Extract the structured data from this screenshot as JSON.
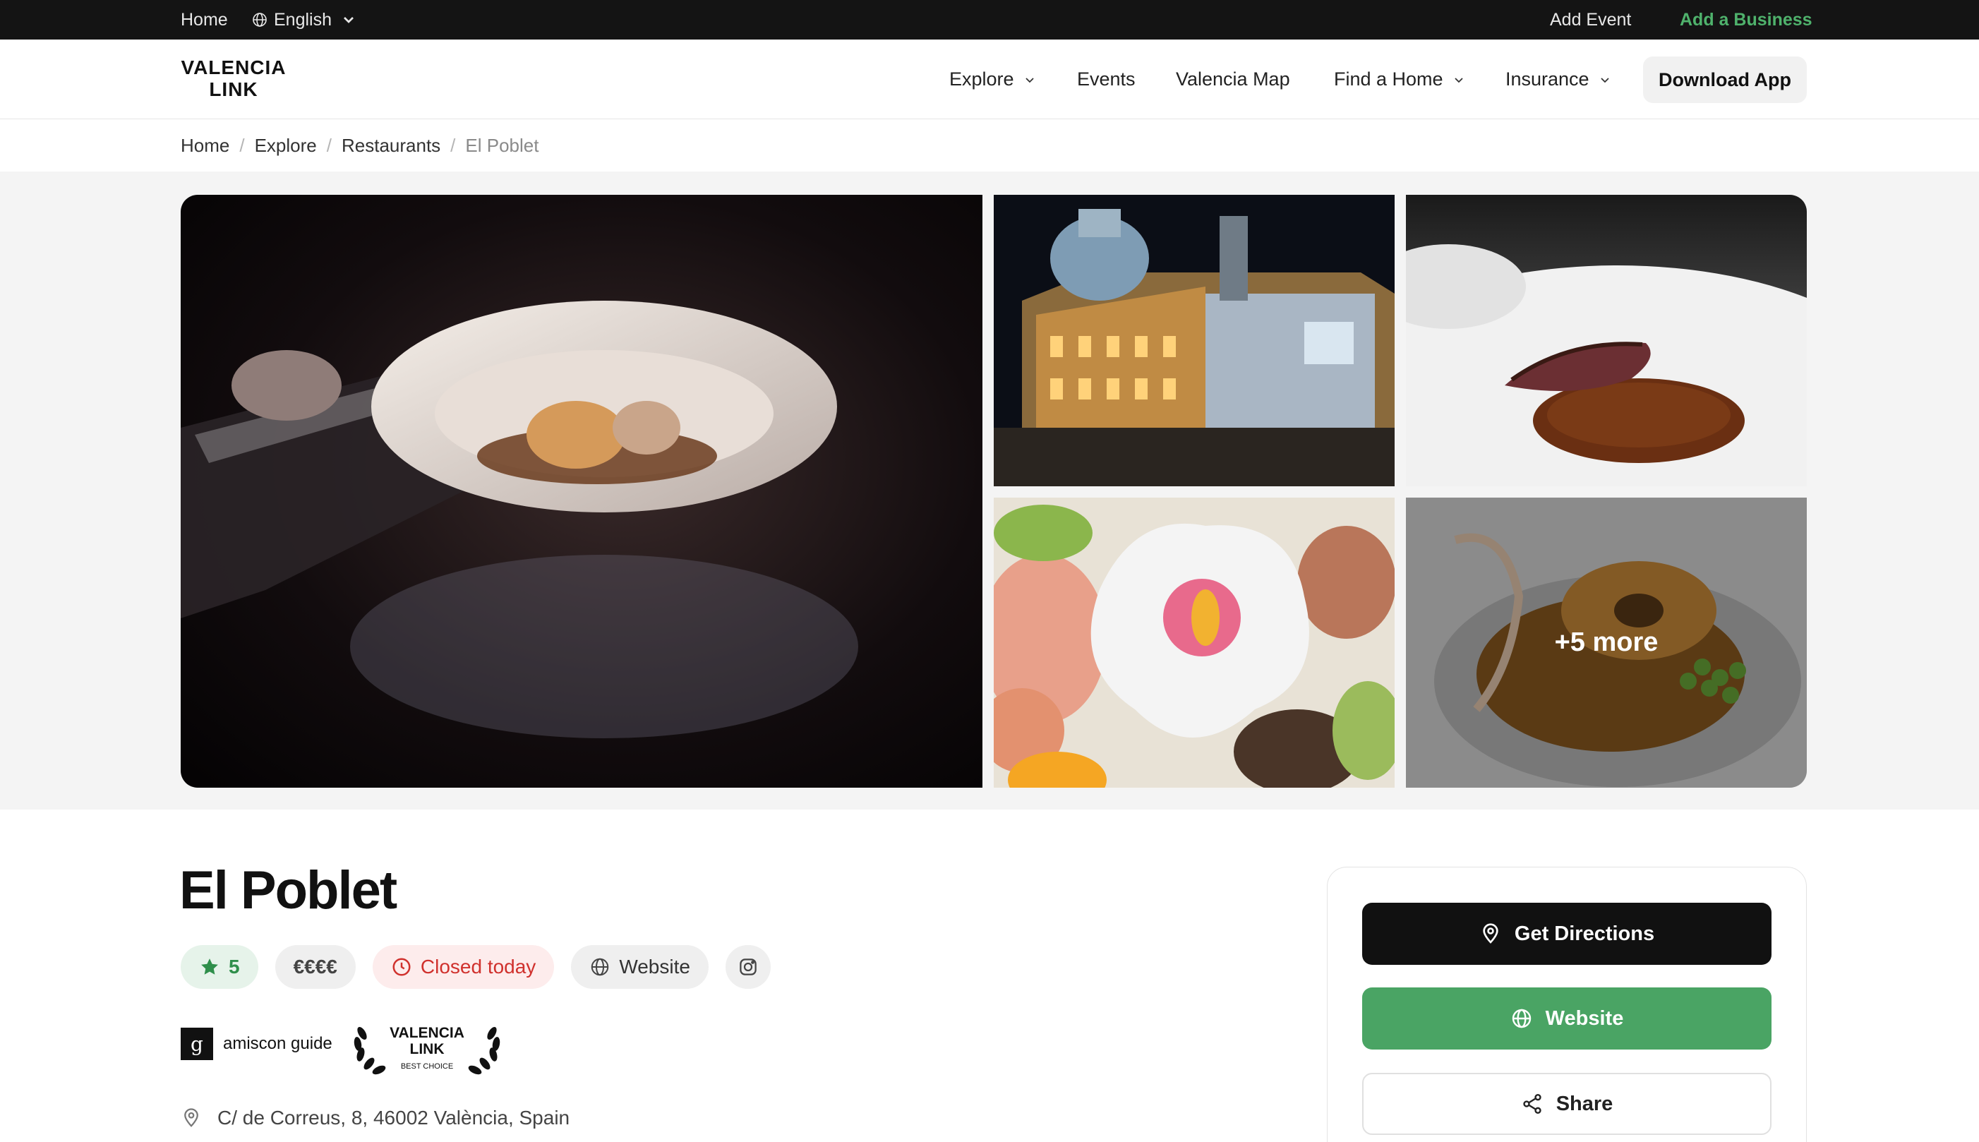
{
  "topbar": {
    "home": "Home",
    "language": "English",
    "add_event": "Add Event",
    "add_business": "Add a Business"
  },
  "header": {
    "logo_line1": "VALENCIA",
    "logo_line2": "LINK",
    "nav": {
      "explore": "Explore",
      "events": "Events",
      "map": "Valencia Map",
      "find_home": "Find a Home",
      "insurance": "Insurance"
    },
    "download": "Download App"
  },
  "breadcrumb": {
    "home": "Home",
    "explore": "Explore",
    "restaurants": "Restaurants",
    "current": "El Poblet"
  },
  "gallery": {
    "more_label": "+5 more"
  },
  "listing": {
    "name": "El Poblet",
    "rating": "5",
    "price": "€€€€",
    "status": "Closed today",
    "website_chip": "Website",
    "address": "C/ de Correus, 8, 46002 València, Spain"
  },
  "badges": {
    "amiscon_mark": "g",
    "amiscon_text": "amiscon guide",
    "award_line1": "VALENCIA",
    "award_line2": "LINK",
    "award_line3": "BEST CHOICE"
  },
  "actions": {
    "directions": "Get Directions",
    "website": "Website",
    "share": "Share"
  },
  "colors": {
    "accent_green": "#4aa464",
    "closed_red": "#d0312d",
    "topbar_bg": "#141414",
    "primary_dark": "#111111"
  }
}
